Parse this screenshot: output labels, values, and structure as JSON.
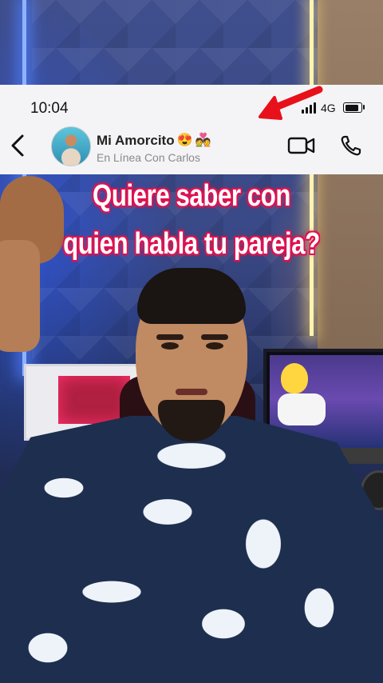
{
  "status_bar": {
    "time": "10:04",
    "network": "4G",
    "icons": [
      "signal-bars-icon",
      "battery-icon"
    ]
  },
  "chat_header": {
    "contact_name": "Mi Amorcito",
    "name_emojis": [
      "😍",
      "💑"
    ],
    "status": "En Línea Con Carlos",
    "actions": [
      "back-chevron-icon",
      "video-camera-icon",
      "phone-icon"
    ]
  },
  "overlay": {
    "arrow_color": "#e8101a"
  },
  "caption": {
    "line1": "Quiere saber con",
    "line2": "quien habla tu pareja?",
    "outline_color": "#e0114f"
  }
}
